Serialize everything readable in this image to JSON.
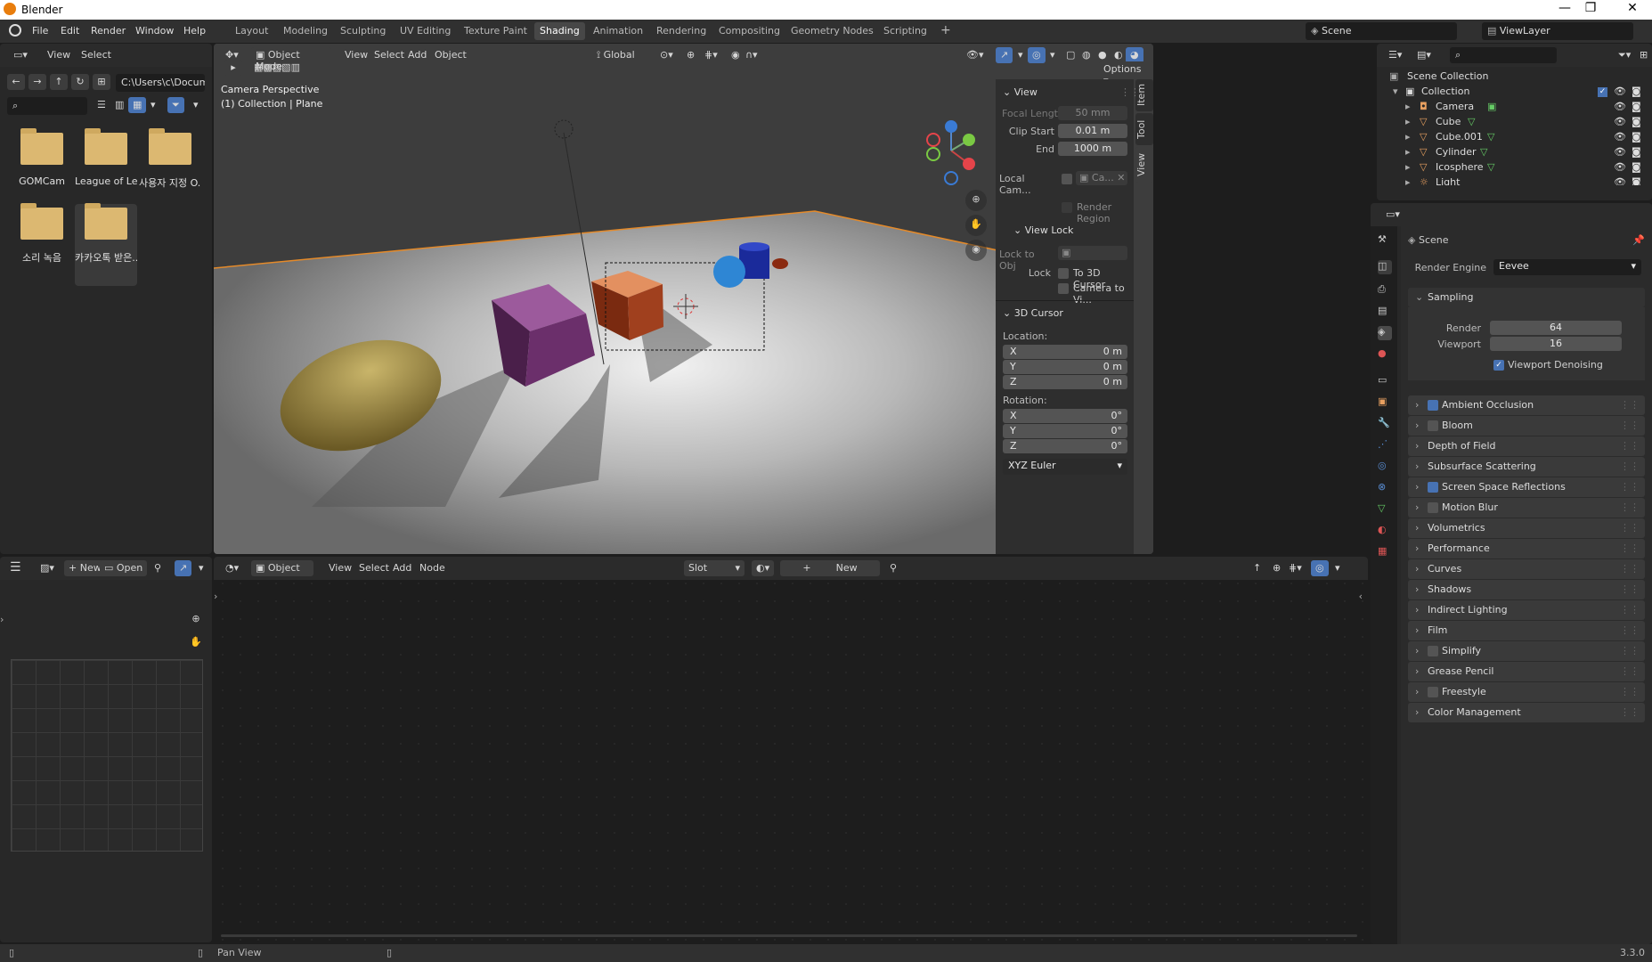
{
  "app": {
    "title": "Blender",
    "version": "3.3.0"
  },
  "window_controls": {
    "minimize": "—",
    "maximize": "❐",
    "close": "✕"
  },
  "menu": {
    "items": [
      "File",
      "Edit",
      "Render",
      "Window",
      "Help"
    ]
  },
  "workspaces": {
    "tabs": [
      "Layout",
      "Modeling",
      "Sculpting",
      "UV Editing",
      "Texture Paint",
      "Shading",
      "Animation",
      "Rendering",
      "Compositing",
      "Geometry Nodes",
      "Scripting"
    ],
    "active": "Shading",
    "add": "+"
  },
  "scene_selector": {
    "value": "Scene"
  },
  "viewlayer_selector": {
    "value": "ViewLayer"
  },
  "file_browser": {
    "menu": [
      "View",
      "Select"
    ],
    "path": "C:\\Users\\c\\Documen...",
    "folders": [
      "GOMCam",
      "League of Leg...",
      "사용자 지정 O...",
      "소리 녹음",
      "카카오톡 받은..."
    ]
  },
  "viewport": {
    "mode": "Object Mode",
    "menu": [
      "View",
      "Select",
      "Add",
      "Object"
    ],
    "orientation": "Global",
    "options_label": "Options",
    "camera_label": "Camera Perspective",
    "collection_label": "(1) Collection | Plane"
  },
  "npanel": {
    "tabs": [
      "Item",
      "Tool",
      "View"
    ],
    "view_header": "View",
    "focal_length": {
      "label": "Focal Lengt",
      "value": "50 mm"
    },
    "clip_start": {
      "label": "Clip Start",
      "value": "0.01 m"
    },
    "clip_end": {
      "label": "End",
      "value": "1000 m"
    },
    "local_camera": {
      "label": "Local Cam...",
      "value": "Ca..."
    },
    "render_region": "Render Region",
    "view_lock_header": "View Lock",
    "lock_to_obj": "Lock to Obj",
    "lock_label": "Lock",
    "lock_3d_cursor": "To 3D Cursor",
    "lock_camera": "Camera to Vi...",
    "cursor_header": "3D Cursor",
    "location_label": "Location:",
    "location": [
      {
        "axis": "X",
        "value": "0 m"
      },
      {
        "axis": "Y",
        "value": "0 m"
      },
      {
        "axis": "Z",
        "value": "0 m"
      }
    ],
    "rotation_label": "Rotation:",
    "rotation": [
      {
        "axis": "X",
        "value": "0°"
      },
      {
        "axis": "Y",
        "value": "0°"
      },
      {
        "axis": "Z",
        "value": "0°"
      }
    ],
    "rotation_mode": "XYZ Euler"
  },
  "outliner": {
    "root": "Scene Collection",
    "collection": "Collection",
    "items": [
      "Camera",
      "Cube",
      "Cube.001",
      "Cylinder",
      "Icosphere",
      "Light"
    ]
  },
  "properties": {
    "scene": "Scene",
    "render_engine_label": "Render Engine",
    "render_engine": "Eevee",
    "sampling_header": "Sampling",
    "render_label": "Render",
    "render_value": "64",
    "viewport_label": "Viewport",
    "viewport_value": "16",
    "viewport_denoising": "Viewport Denoising",
    "sections": [
      {
        "label": "Ambient Occlusion",
        "checkbox": true,
        "checked": true
      },
      {
        "label": "Bloom",
        "checkbox": true,
        "checked": false
      },
      {
        "label": "Depth of Field",
        "checkbox": false,
        "checked": false
      },
      {
        "label": "Subsurface Scattering",
        "checkbox": false,
        "checked": false
      },
      {
        "label": "Screen Space Reflections",
        "checkbox": true,
        "checked": true
      },
      {
        "label": "Motion Blur",
        "checkbox": true,
        "checked": false
      },
      {
        "label": "Volumetrics",
        "checkbox": false,
        "checked": false
      },
      {
        "label": "Performance",
        "checkbox": false,
        "checked": false
      },
      {
        "label": "Curves",
        "checkbox": false,
        "checked": false
      },
      {
        "label": "Shadows",
        "checkbox": false,
        "checked": false
      },
      {
        "label": "Indirect Lighting",
        "checkbox": false,
        "checked": false
      },
      {
        "label": "Film",
        "checkbox": false,
        "checked": false
      },
      {
        "label": "Simplify",
        "checkbox": true,
        "checked": false
      },
      {
        "label": "Grease Pencil",
        "checkbox": false,
        "checked": false
      },
      {
        "label": "Freestyle",
        "checkbox": true,
        "checked": false
      },
      {
        "label": "Color Management",
        "checkbox": false,
        "checked": false
      }
    ]
  },
  "image_editor": {
    "new": "New",
    "open": "Open"
  },
  "node_editor": {
    "type": "Object",
    "menu": [
      "View",
      "Select",
      "Add",
      "Node"
    ],
    "slot": "Slot",
    "new": "New"
  },
  "statusbar": {
    "hint": "Pan View"
  },
  "colors": {
    "accent": "#4772b3",
    "orange": "#e87d0d",
    "folder": "#dcb871"
  }
}
